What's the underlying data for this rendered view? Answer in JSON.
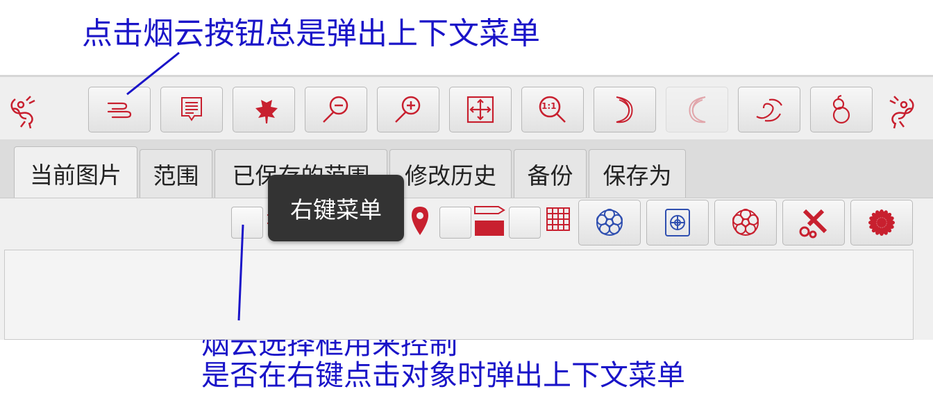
{
  "annotations": {
    "top": "点击烟云按钮总是弹出上下文菜单",
    "bottom_line1": "烟云选择框用来控制",
    "bottom_line2": "是否在右键点击对象时弹出上下文菜单"
  },
  "toolbar": {
    "buttons": [
      {
        "icon": "cloud-swirl-icon",
        "state": "normal"
      },
      {
        "icon": "list-document-icon",
        "state": "normal"
      },
      {
        "icon": "maple-leaf-icon",
        "state": "normal"
      },
      {
        "icon": "zoom-out-icon",
        "state": "normal"
      },
      {
        "icon": "zoom-in-icon",
        "state": "normal"
      },
      {
        "icon": "fit-to-window-icon",
        "state": "normal"
      },
      {
        "icon": "zoom-actual-size-icon",
        "state": "normal"
      },
      {
        "icon": "crescent-moon-right-icon",
        "state": "normal"
      },
      {
        "icon": "crescent-moon-left-icon",
        "state": "disabled"
      },
      {
        "icon": "wind-swirl-icon",
        "state": "normal"
      },
      {
        "icon": "gourd-icon",
        "state": "normal"
      }
    ],
    "zoom_actual_label": "1:1"
  },
  "tabs": [
    {
      "label": "当前图片",
      "active": true
    },
    {
      "label": "范围",
      "active": false
    },
    {
      "label": "已保存的范围",
      "active": false
    },
    {
      "label": "修改历史",
      "active": false
    },
    {
      "label": "备份",
      "active": false
    },
    {
      "label": "保存为",
      "active": false
    }
  ],
  "panel": {
    "toggles": [
      {
        "icon": "cloud-swirl-icon",
        "checked": false
      },
      {
        "icon": "eyedropper-icon",
        "checked": false
      },
      {
        "icon": "location-pin-icon",
        "checked": false
      },
      {
        "icon": "pencil-bar-icon",
        "checked": false
      },
      {
        "icon": "grid-icon",
        "checked": false
      }
    ],
    "action_buttons": [
      "flower-outline-blue-icon",
      "flower-in-square-icon",
      "flower-outline-red-icon",
      "scissors-icon",
      "chrysanthemum-icon"
    ]
  },
  "tooltip": {
    "text": "右键菜单"
  },
  "colors": {
    "icon_red": "#c8202f",
    "icon_blue": "#2f4fb0",
    "annotation_blue": "#1a14c8"
  }
}
